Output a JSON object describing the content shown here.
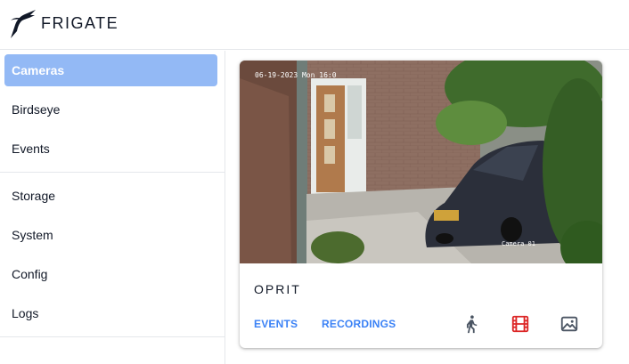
{
  "app": {
    "brand": "FRIGATE",
    "logo_icon": "frigate-bird-logo-icon"
  },
  "sidebar": {
    "items": [
      {
        "label": "Cameras",
        "active": true
      },
      {
        "label": "Birdseye",
        "active": false
      },
      {
        "label": "Events",
        "active": false
      },
      {
        "label": "Storage",
        "active": false
      },
      {
        "label": "System",
        "active": false
      },
      {
        "label": "Config",
        "active": false
      },
      {
        "label": "Logs",
        "active": false
      }
    ]
  },
  "camera_card": {
    "name": "OPRIT",
    "overlay_timestamp": "06-19-2023 Mon 16:0",
    "overlay_camera": "Camera 01",
    "links": {
      "events": "EVENTS",
      "recordings": "RECORDINGS"
    },
    "icons": {
      "detect": "person-walking-icon",
      "record": "film-icon",
      "snapshot": "image-icon"
    }
  },
  "colors": {
    "accent": "#3b82f6",
    "active_nav_bg": "#93b9f5",
    "record_icon": "#dc2626",
    "icon_default": "#4b5563"
  }
}
